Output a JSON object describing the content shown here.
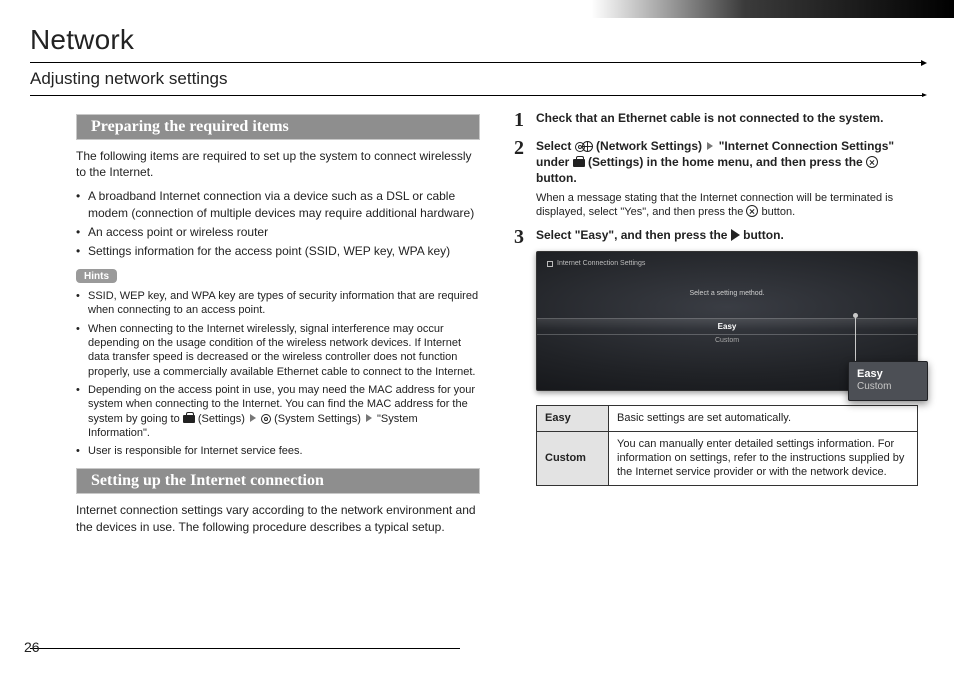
{
  "page_number": "26",
  "chapter_title": "Network",
  "section_title": "Adjusting network settings",
  "left": {
    "heading_preparing": "Preparing the required items",
    "preparing_intro": "The following items are required to set up the system to connect wirelessly to the Internet.",
    "preparing_items": [
      "A broadband Internet connection via a device such as a DSL or cable modem (connection of multiple devices may require additional hardware)",
      "An access point or wireless router",
      "Settings information for the access point (SSID, WEP key, WPA key)"
    ],
    "hints_label": "Hints",
    "hints": [
      "SSID, WEP key, and WPA key are types of security information that are required when connecting to an access point.",
      "When connecting to the Internet wirelessly, signal interference may occur depending on the usage condition of the wireless network devices. If Internet data transfer speed is decreased or the wireless controller does not function properly, use a commercially available Ethernet cable to connect to the Internet.",
      "Depending on the access point in use, you may need the MAC address for your system when connecting to the Internet. You can find the MAC address for the system by going to  (Settings)   (System Settings)  \"System Information\".",
      "User is responsible for Internet service fees."
    ],
    "heading_setup": "Setting up the Internet connection",
    "setup_intro": "Internet connection settings vary according to the network environment and the devices in use. The following procedure describes a typical setup."
  },
  "right": {
    "steps": [
      {
        "num": "1",
        "title": "Check that an Ethernet cable is not connected to the system."
      },
      {
        "num": "2",
        "title_pre": "Select ",
        "title_mid1": " (Network Settings) ",
        "title_mid2": " \"Internet Connection Settings\" under ",
        "title_mid3": " (Settings) in the home menu, and then press the ",
        "title_post": " button.",
        "note_pre": "When a message stating that the Internet connection will be terminated is displayed, select \"Yes\", and then press the ",
        "note_post": " button."
      },
      {
        "num": "3",
        "title_pre": "Select \"Easy\", and then press the ",
        "title_post": " button."
      }
    ],
    "screenshot": {
      "breadcrumb": "Internet Connection Settings",
      "prompt": "Select a setting method.",
      "option_easy": "Easy",
      "option_custom": "Custom"
    },
    "callout": {
      "easy": "Easy",
      "custom": "Custom"
    },
    "table": [
      {
        "key": "Easy",
        "desc": "Basic settings are set automatically."
      },
      {
        "key": "Custom",
        "desc": "You can manually enter detailed settings information. For information on settings, refer to the instructions supplied by the Internet service provider or with the network device."
      }
    ]
  }
}
